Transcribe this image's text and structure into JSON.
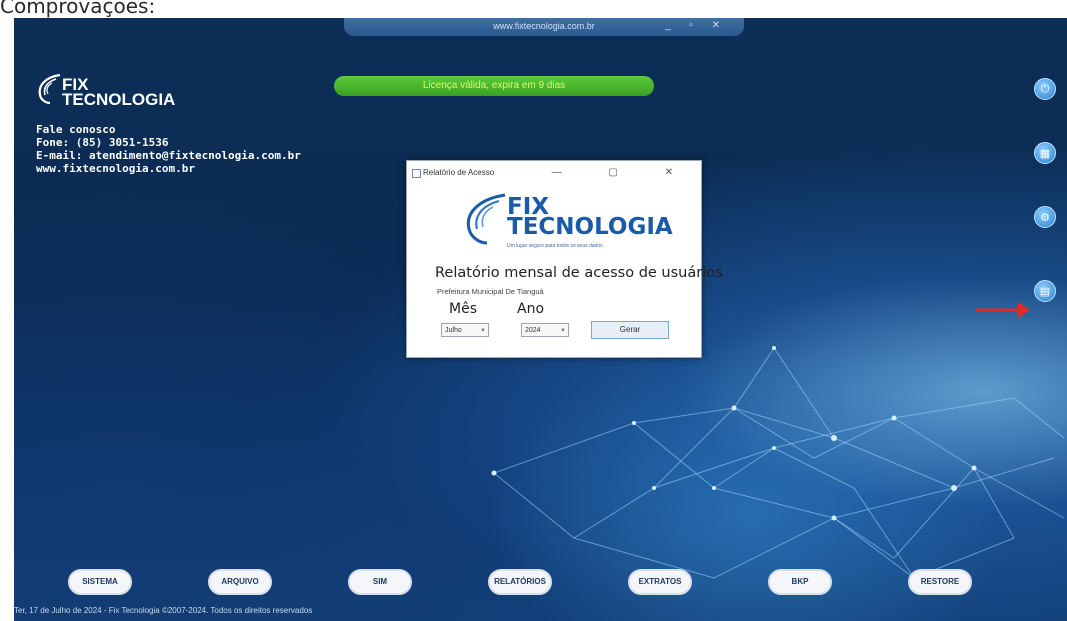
{
  "caption": "Comprovações:",
  "window": {
    "title": "www.fixtecnologia.com.br",
    "controls": [
      "_",
      "▫",
      "✕"
    ]
  },
  "brand": {
    "logo_line1": "FIX",
    "logo_line2": "TECNOLOGIA"
  },
  "contact": {
    "heading": "Fale conosco",
    "phone": "Fone: (85) 3051-1536",
    "email": "E-mail: atendimento@fixtecnologia.com.br",
    "site": "www.fixtecnologia.com.br"
  },
  "license_banner": "Licença válida, expira em 9 dias",
  "side_icons": [
    "power-icon",
    "calculator-icon",
    "settings-icon",
    "report-icon"
  ],
  "dialog": {
    "title": "Relatório de Acesso",
    "controls": [
      "—",
      "▢",
      "✕"
    ],
    "logo_line1": "FIX",
    "logo_line2": "TECNOLOGIA",
    "slogan": "Um lugar seguro para todos os seus dados",
    "heading": "Relatório mensal de acesso de usuários",
    "subtitle": "Prefeitura Municipal De Tianguá",
    "month_label": "Mês",
    "year_label": "Ano",
    "month_value": "Julho",
    "year_value": "2024",
    "generate_button": "Gerar"
  },
  "menu": [
    "SISTEMA",
    "ARQUIVO",
    "SIM",
    "RELATÓRIOS",
    "EXTRATOS",
    "BKP",
    "RESTORE"
  ],
  "footer": "Ter, 17 de Julho de 2024 - Fix Tecnologia ©2007-2024. Todos os direitos reservados"
}
